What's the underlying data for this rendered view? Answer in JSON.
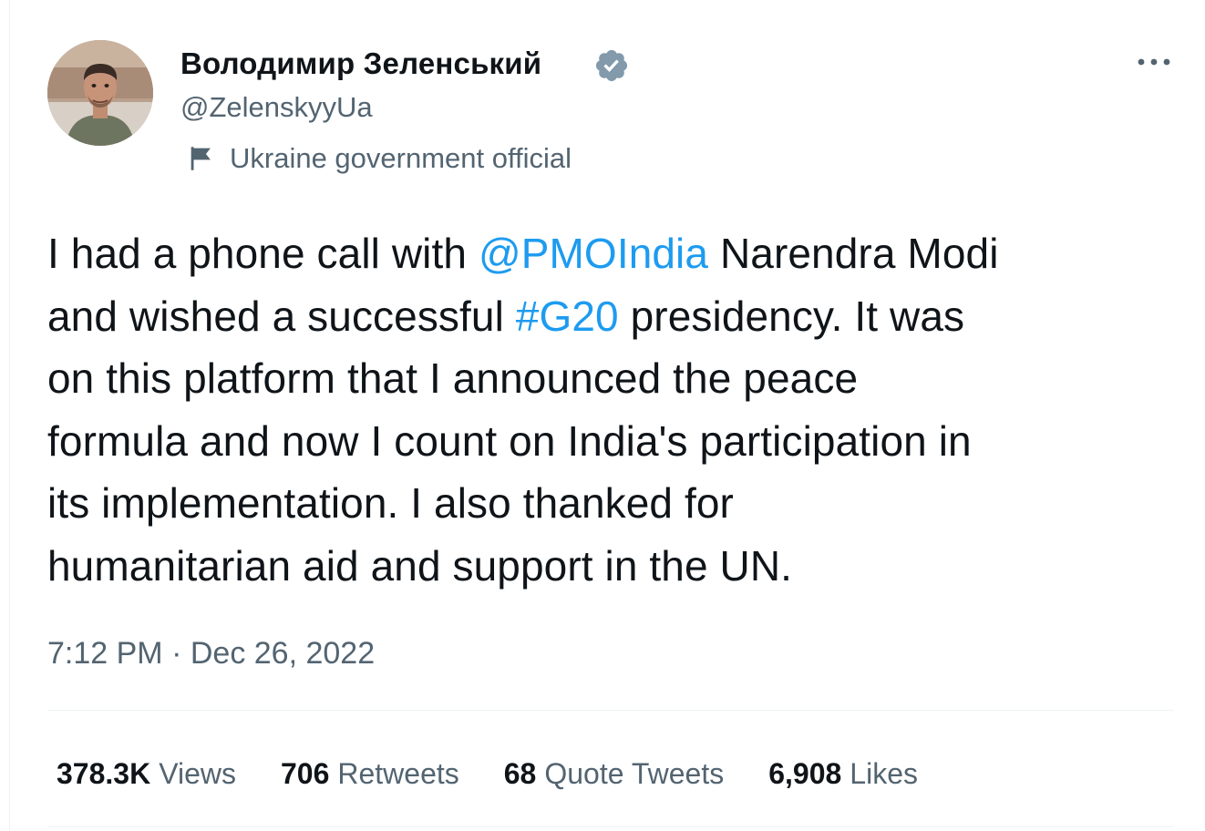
{
  "author": {
    "display_name": "Володимир Зеленський",
    "handle": "@ZelenskyyUa",
    "label": "Ukraine government official",
    "verified_color": "#829aab",
    "avatar_icon": "user-avatar-photo"
  },
  "tweet": {
    "lines": [
      {
        "pre": "I had a phone call with ",
        "mention": "@PMOIndia",
        "post": " Narendra Modi"
      },
      {
        "pre": "and wished a successful ",
        "hashtag": "#G20",
        "post": " presidency. It was"
      },
      {
        "text": "on this platform that I announced the peace"
      },
      {
        "text": "formula and now I count on India's participation in"
      },
      {
        "text": "its implementation. I also thanked for"
      },
      {
        "text": "humanitarian aid and support in the UN."
      }
    ],
    "time": "7:12 PM",
    "separator": "·",
    "date": "Dec 26, 2022",
    "link_color": "#1d9bf0"
  },
  "stats": {
    "views_value": "378.3K",
    "views_label": "Views",
    "retweets_value": "706",
    "retweets_label": "Retweets",
    "quotes_value": "68",
    "quotes_label": "Quote Tweets",
    "likes_value": "6,908",
    "likes_label": "Likes"
  },
  "icons": {
    "more": "more-horizontal-icon",
    "verified": "verified-badge-icon",
    "flag": "flag-icon"
  }
}
